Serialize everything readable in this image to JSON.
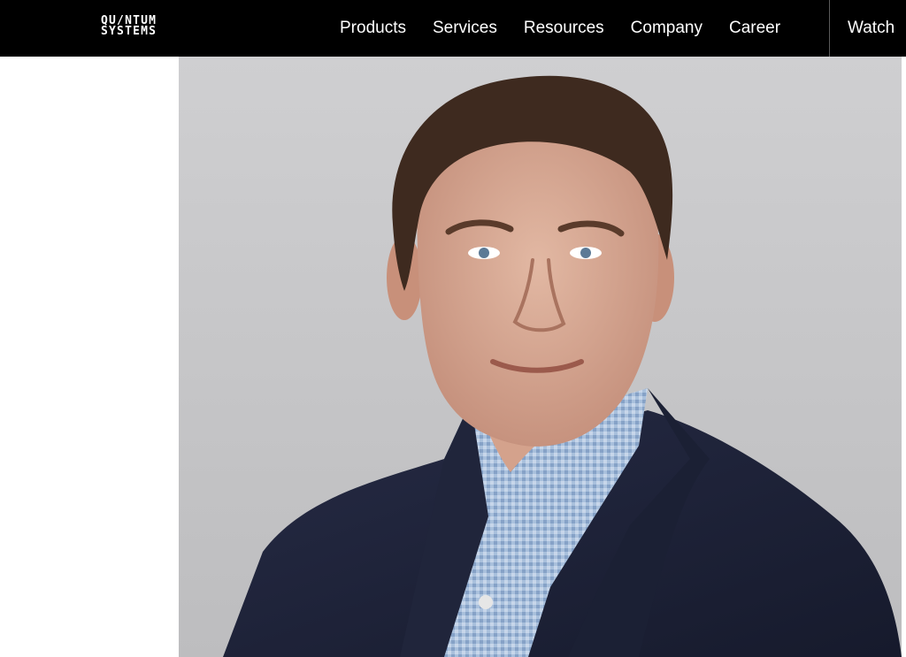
{
  "brand": {
    "line1": "QU/NTUM",
    "line2": "SYSTEMS"
  },
  "nav": {
    "items": [
      "Products",
      "Services",
      "Resources",
      "Company",
      "Career"
    ],
    "watch_label": "Watch"
  },
  "hero": {
    "image_icon": "portrait-photo"
  },
  "colors": {
    "topbar": "#000000",
    "nav_text": "#ffffff",
    "photo_background": "#c9c9cb",
    "jacket": "#1f2439",
    "shirt": "#9fb8d6"
  }
}
